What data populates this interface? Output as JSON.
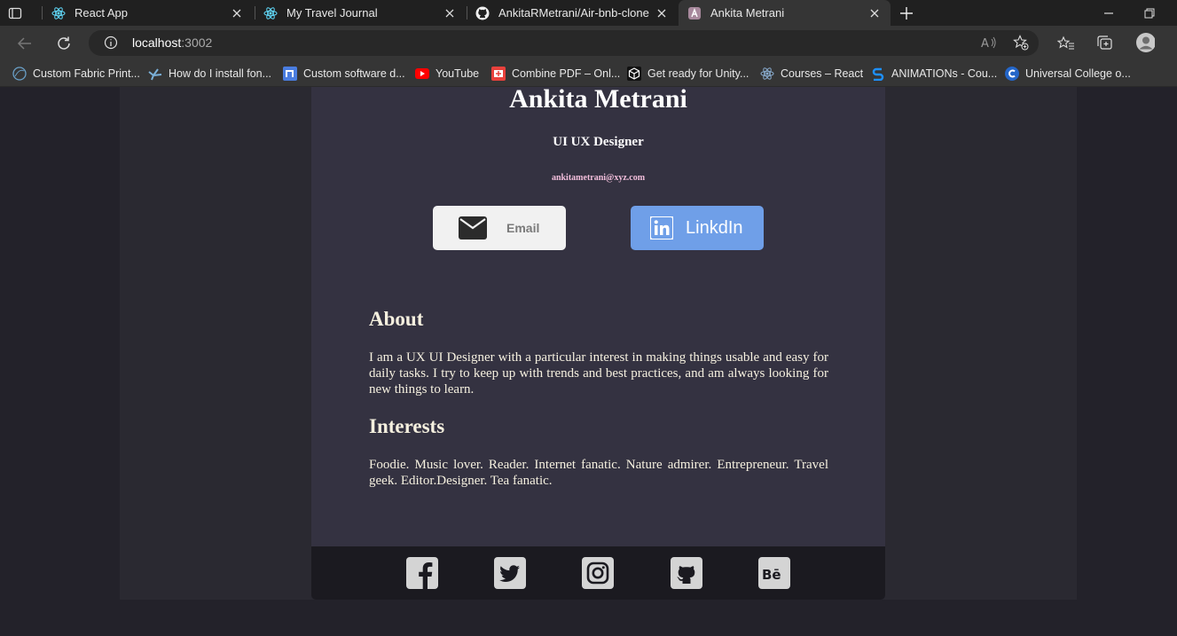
{
  "browser": {
    "tabs": [
      {
        "title": "React App",
        "icon": "react-icon"
      },
      {
        "title": "My Travel Journal",
        "icon": "react-icon"
      },
      {
        "title": "AnkitaRMetrani/Air-bnb-clone",
        "icon": "github-icon"
      },
      {
        "title": "Ankita Metrani",
        "icon": "app-logo-icon",
        "active": true
      }
    ],
    "address": {
      "host": "localhost",
      "port": ":3002"
    },
    "bookmarks": [
      {
        "label": "Custom Fabric Print...",
        "icon": "globe-icon"
      },
      {
        "label": "How do I install fon...",
        "icon": "bird-icon"
      },
      {
        "label": "Custom software d...",
        "icon": "n-logo-icon"
      },
      {
        "label": "YouTube",
        "icon": "youtube-icon"
      },
      {
        "label": "Combine PDF – Onl...",
        "icon": "pdf-icon"
      },
      {
        "label": "Get ready for Unity...",
        "icon": "unity-icon"
      },
      {
        "label": "Courses – React",
        "icon": "react-icon"
      },
      {
        "label": "ANIMATIONs - Cou...",
        "icon": "s-logo-icon"
      },
      {
        "label": "Universal College o...",
        "icon": "c-logo-icon"
      }
    ]
  },
  "profile": {
    "name": "Ankita Metrani",
    "role": "UI UX Designer",
    "email": "ankitametrani@xyz.com",
    "buttons": {
      "email": "Email",
      "linkedin": "LinkdIn"
    }
  },
  "about": {
    "heading": "About",
    "text": "I am a UX UI Designer with a particular interest in making things usable and easy for daily tasks. I try to keep up with trends and best practices, and am always looking for new things to learn."
  },
  "interests": {
    "heading": "Interests",
    "text": "Foodie. Music lover. Reader. Internet fanatic. Nature admirer. Entrepreneur. Travel geek. Editor.Designer. Tea fanatic."
  },
  "footer": {
    "icons": [
      "facebook-icon",
      "twitter-icon",
      "instagram-icon",
      "github-icon",
      "behance-icon"
    ]
  },
  "colors": {
    "page_bg": "#23222a",
    "card_bg": "#343241",
    "footer_bg": "#1b1a20",
    "linkedin_button": "#6f9fe8",
    "email_text": "#f3bfdc",
    "body_text": "#f5f0df"
  }
}
